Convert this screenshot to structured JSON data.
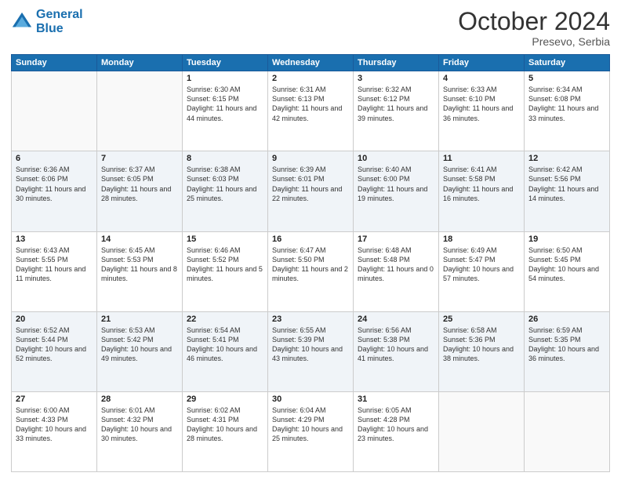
{
  "header": {
    "logo_line1": "General",
    "logo_line2": "Blue",
    "month": "October 2024",
    "location": "Presevo, Serbia"
  },
  "weekdays": [
    "Sunday",
    "Monday",
    "Tuesday",
    "Wednesday",
    "Thursday",
    "Friday",
    "Saturday"
  ],
  "weeks": [
    [
      {
        "day": "",
        "sunrise": "",
        "sunset": "",
        "daylight": ""
      },
      {
        "day": "",
        "sunrise": "",
        "sunset": "",
        "daylight": ""
      },
      {
        "day": "1",
        "sunrise": "Sunrise: 6:30 AM",
        "sunset": "Sunset: 6:15 PM",
        "daylight": "Daylight: 11 hours and 44 minutes."
      },
      {
        "day": "2",
        "sunrise": "Sunrise: 6:31 AM",
        "sunset": "Sunset: 6:13 PM",
        "daylight": "Daylight: 11 hours and 42 minutes."
      },
      {
        "day": "3",
        "sunrise": "Sunrise: 6:32 AM",
        "sunset": "Sunset: 6:12 PM",
        "daylight": "Daylight: 11 hours and 39 minutes."
      },
      {
        "day": "4",
        "sunrise": "Sunrise: 6:33 AM",
        "sunset": "Sunset: 6:10 PM",
        "daylight": "Daylight: 11 hours and 36 minutes."
      },
      {
        "day": "5",
        "sunrise": "Sunrise: 6:34 AM",
        "sunset": "Sunset: 6:08 PM",
        "daylight": "Daylight: 11 hours and 33 minutes."
      }
    ],
    [
      {
        "day": "6",
        "sunrise": "Sunrise: 6:36 AM",
        "sunset": "Sunset: 6:06 PM",
        "daylight": "Daylight: 11 hours and 30 minutes."
      },
      {
        "day": "7",
        "sunrise": "Sunrise: 6:37 AM",
        "sunset": "Sunset: 6:05 PM",
        "daylight": "Daylight: 11 hours and 28 minutes."
      },
      {
        "day": "8",
        "sunrise": "Sunrise: 6:38 AM",
        "sunset": "Sunset: 6:03 PM",
        "daylight": "Daylight: 11 hours and 25 minutes."
      },
      {
        "day": "9",
        "sunrise": "Sunrise: 6:39 AM",
        "sunset": "Sunset: 6:01 PM",
        "daylight": "Daylight: 11 hours and 22 minutes."
      },
      {
        "day": "10",
        "sunrise": "Sunrise: 6:40 AM",
        "sunset": "Sunset: 6:00 PM",
        "daylight": "Daylight: 11 hours and 19 minutes."
      },
      {
        "day": "11",
        "sunrise": "Sunrise: 6:41 AM",
        "sunset": "Sunset: 5:58 PM",
        "daylight": "Daylight: 11 hours and 16 minutes."
      },
      {
        "day": "12",
        "sunrise": "Sunrise: 6:42 AM",
        "sunset": "Sunset: 5:56 PM",
        "daylight": "Daylight: 11 hours and 14 minutes."
      }
    ],
    [
      {
        "day": "13",
        "sunrise": "Sunrise: 6:43 AM",
        "sunset": "Sunset: 5:55 PM",
        "daylight": "Daylight: 11 hours and 11 minutes."
      },
      {
        "day": "14",
        "sunrise": "Sunrise: 6:45 AM",
        "sunset": "Sunset: 5:53 PM",
        "daylight": "Daylight: 11 hours and 8 minutes."
      },
      {
        "day": "15",
        "sunrise": "Sunrise: 6:46 AM",
        "sunset": "Sunset: 5:52 PM",
        "daylight": "Daylight: 11 hours and 5 minutes."
      },
      {
        "day": "16",
        "sunrise": "Sunrise: 6:47 AM",
        "sunset": "Sunset: 5:50 PM",
        "daylight": "Daylight: 11 hours and 2 minutes."
      },
      {
        "day": "17",
        "sunrise": "Sunrise: 6:48 AM",
        "sunset": "Sunset: 5:48 PM",
        "daylight": "Daylight: 11 hours and 0 minutes."
      },
      {
        "day": "18",
        "sunrise": "Sunrise: 6:49 AM",
        "sunset": "Sunset: 5:47 PM",
        "daylight": "Daylight: 10 hours and 57 minutes."
      },
      {
        "day": "19",
        "sunrise": "Sunrise: 6:50 AM",
        "sunset": "Sunset: 5:45 PM",
        "daylight": "Daylight: 10 hours and 54 minutes."
      }
    ],
    [
      {
        "day": "20",
        "sunrise": "Sunrise: 6:52 AM",
        "sunset": "Sunset: 5:44 PM",
        "daylight": "Daylight: 10 hours and 52 minutes."
      },
      {
        "day": "21",
        "sunrise": "Sunrise: 6:53 AM",
        "sunset": "Sunset: 5:42 PM",
        "daylight": "Daylight: 10 hours and 49 minutes."
      },
      {
        "day": "22",
        "sunrise": "Sunrise: 6:54 AM",
        "sunset": "Sunset: 5:41 PM",
        "daylight": "Daylight: 10 hours and 46 minutes."
      },
      {
        "day": "23",
        "sunrise": "Sunrise: 6:55 AM",
        "sunset": "Sunset: 5:39 PM",
        "daylight": "Daylight: 10 hours and 43 minutes."
      },
      {
        "day": "24",
        "sunrise": "Sunrise: 6:56 AM",
        "sunset": "Sunset: 5:38 PM",
        "daylight": "Daylight: 10 hours and 41 minutes."
      },
      {
        "day": "25",
        "sunrise": "Sunrise: 6:58 AM",
        "sunset": "Sunset: 5:36 PM",
        "daylight": "Daylight: 10 hours and 38 minutes."
      },
      {
        "day": "26",
        "sunrise": "Sunrise: 6:59 AM",
        "sunset": "Sunset: 5:35 PM",
        "daylight": "Daylight: 10 hours and 36 minutes."
      }
    ],
    [
      {
        "day": "27",
        "sunrise": "Sunrise: 6:00 AM",
        "sunset": "Sunset: 4:33 PM",
        "daylight": "Daylight: 10 hours and 33 minutes."
      },
      {
        "day": "28",
        "sunrise": "Sunrise: 6:01 AM",
        "sunset": "Sunset: 4:32 PM",
        "daylight": "Daylight: 10 hours and 30 minutes."
      },
      {
        "day": "29",
        "sunrise": "Sunrise: 6:02 AM",
        "sunset": "Sunset: 4:31 PM",
        "daylight": "Daylight: 10 hours and 28 minutes."
      },
      {
        "day": "30",
        "sunrise": "Sunrise: 6:04 AM",
        "sunset": "Sunset: 4:29 PM",
        "daylight": "Daylight: 10 hours and 25 minutes."
      },
      {
        "day": "31",
        "sunrise": "Sunrise: 6:05 AM",
        "sunset": "Sunset: 4:28 PM",
        "daylight": "Daylight: 10 hours and 23 minutes."
      },
      {
        "day": "",
        "sunrise": "",
        "sunset": "",
        "daylight": ""
      },
      {
        "day": "",
        "sunrise": "",
        "sunset": "",
        "daylight": ""
      }
    ]
  ]
}
